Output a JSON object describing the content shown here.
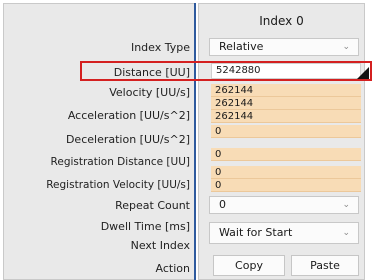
{
  "header": {
    "column_title": "Index 0"
  },
  "labels": {
    "index_type": "Index Type",
    "distance": "Distance [UU]",
    "velocity": "Velocity [UU/s]",
    "acceleration": "Acceleration [UU/s^2]",
    "deceleration": "Deceleration [UU/s^2]",
    "registration_distance": "Registration Distance [UU]",
    "registration_velocity": "Registration Velocity [UU/s]",
    "repeat_count": "Repeat Count",
    "dwell_time": "Dwell Time [ms]",
    "next_index": "Next Index",
    "action": "Action"
  },
  "values": {
    "index_type": "Relative",
    "distance": "5242880",
    "velocity": "262144",
    "acceleration": "262144",
    "deceleration": "262144",
    "registration_distance": "0",
    "registration_velocity": "0",
    "repeat_count": "0",
    "extra_row": "0",
    "dwell_time": "0",
    "next_index": "Wait for Start"
  },
  "buttons": {
    "copy": "Copy",
    "paste": "Paste"
  },
  "colors": {
    "field_bg": "#f8dcb6",
    "highlight": "#d42020",
    "divider": "#2e5a9e"
  }
}
